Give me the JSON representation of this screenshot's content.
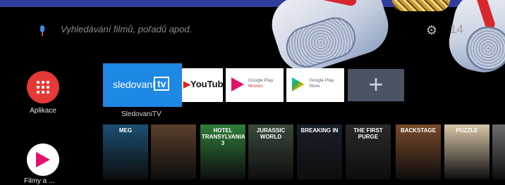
{
  "search": {
    "placeholder": "Vyhledávání filmů, pořadů apod."
  },
  "status": {
    "clock": "14"
  },
  "apps": {
    "apps_label": "Aplikace",
    "movies_label": "Filmy a ..."
  },
  "channels": {
    "sledovani": {
      "name_text": "sledovaní",
      "tv_badge": "tv",
      "label": "SledovaniTV"
    },
    "youtube": {
      "prefix": "▶",
      "label": "YouTube"
    },
    "play_movies": {
      "line1": "Google Play",
      "line2": "Movies"
    },
    "play_store": {
      "line1": "Google Play",
      "line2": "Store"
    },
    "add": {
      "symbol": "+"
    }
  },
  "posters": [
    {
      "title": "MEG",
      "color": "#1d4f74"
    },
    {
      "title": "",
      "color": "#5b3f2b"
    },
    {
      "title": "HOTEL TRANSYLVANIA 3",
      "color": "#2f7d3a"
    },
    {
      "title": "JURASSIC WORLD",
      "color": "#394a3b"
    },
    {
      "title": "BREAKING IN",
      "color": "#1a1f2a"
    },
    {
      "title": "THE FIRST PURGE",
      "color": "#2a2a2a"
    },
    {
      "title": "BACKSTAGE",
      "color": "#7a4a2a"
    },
    {
      "title": "PUZZLE",
      "color": "#d9c7a8"
    },
    {
      "title": "",
      "color": "#6d6d6d"
    }
  ],
  "icons": {
    "mic": "mic-icon",
    "gear": "gear-icon",
    "apps": "apps-grid-icon",
    "movies": "play-movies-icon",
    "plus": "plus-icon"
  }
}
